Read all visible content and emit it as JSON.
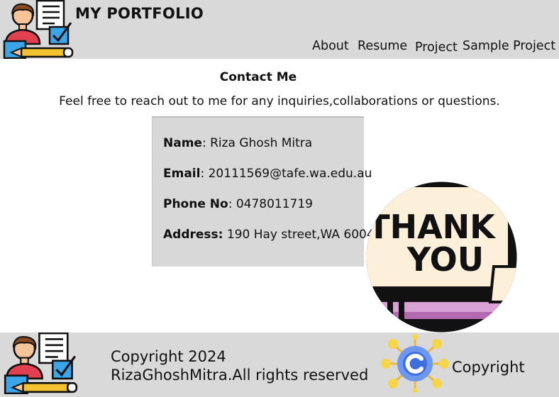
{
  "header": {
    "title": "MY PORTFOLIO",
    "logo_icon": "developer-at-desk-icon",
    "nav": [
      "About",
      "Resume",
      "Project",
      "Sample Project"
    ]
  },
  "contact": {
    "heading": "Contact Me",
    "intro": "Feel free to reach out to me for any inquiries,collaborations or questions.",
    "name_label": "Name",
    "name_value": ": Riza Ghosh Mitra",
    "email_label": "Email",
    "email_value": ": 20111569@tafe.wa.edu.au",
    "phone_label": "Phone No",
    "phone_value": ": 0478011719",
    "address_label": "Address:",
    "address_value": " 190 Hay street,WA 6004"
  },
  "thank_you": {
    "line1": "THANK",
    "line2": "YOU"
  },
  "footer": {
    "line1": "Copyright 2024",
    "line2": "RizaGhoshMitra.All rights reserved",
    "copyright_label": "Copyright",
    "copyright_icon": "copyright-network-icon"
  },
  "colors": {
    "header_bg": "#d9d9d9",
    "card_bg": "#d8d8d8",
    "footer_bg": "#d9d9d9"
  }
}
